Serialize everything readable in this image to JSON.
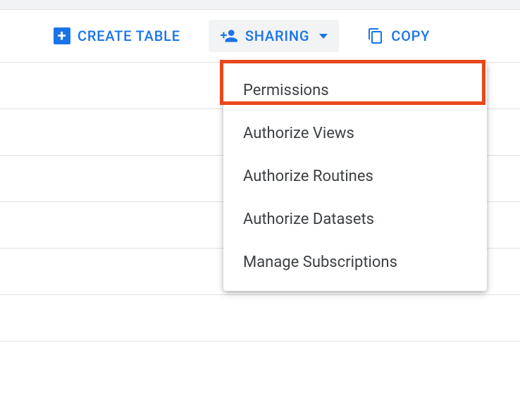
{
  "toolbar": {
    "create_table_label": "CREATE TABLE",
    "sharing_label": "SHARING",
    "copy_label": "COPY"
  },
  "sharing_menu": {
    "items": [
      {
        "label": "Permissions"
      },
      {
        "label": "Authorize Views"
      },
      {
        "label": "Authorize Routines"
      },
      {
        "label": "Authorize Datasets"
      },
      {
        "label": "Manage Subscriptions"
      }
    ]
  }
}
